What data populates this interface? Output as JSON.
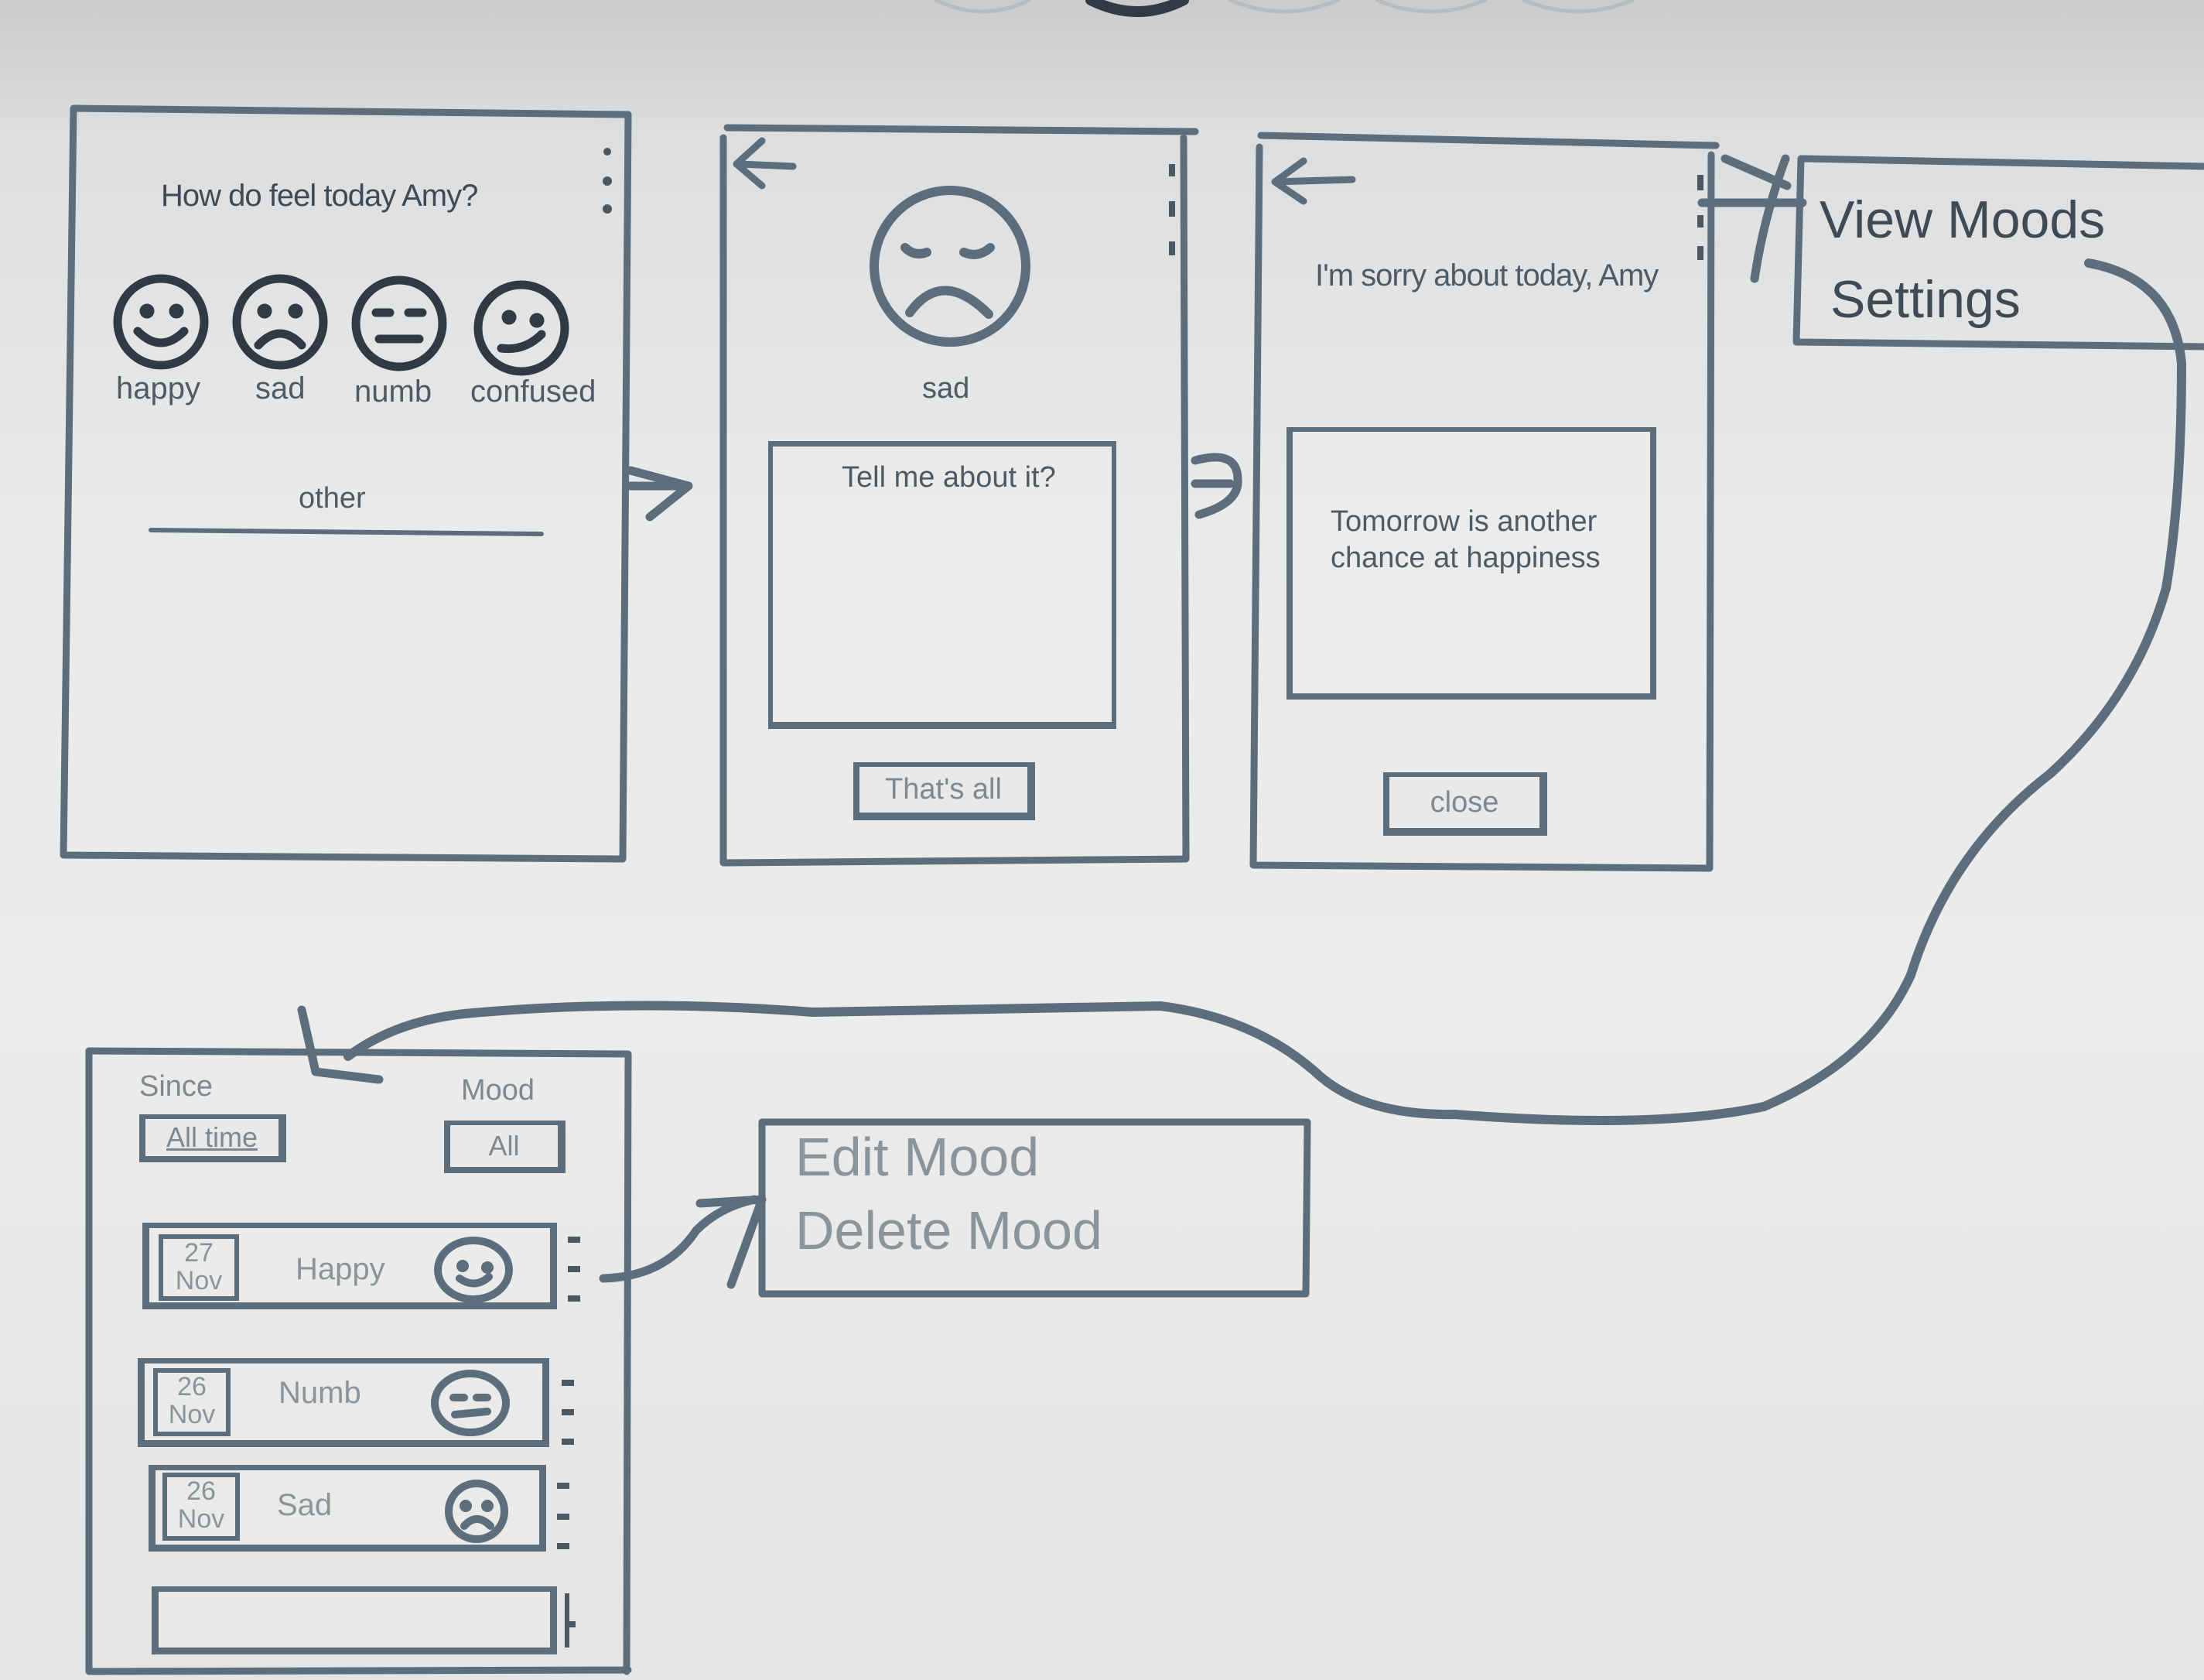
{
  "screen1": {
    "question": "How do feel today Amy?",
    "moods": [
      {
        "label": "happy",
        "icon": "happy-face-icon"
      },
      {
        "label": "sad",
        "icon": "sad-face-icon"
      },
      {
        "label": "numb",
        "icon": "numb-face-icon"
      },
      {
        "label": "confused",
        "icon": "confused-face-icon"
      }
    ],
    "other_label": "other"
  },
  "screen2": {
    "mood_label": "sad",
    "prompt": "Tell me about it?",
    "done_button": "That's all"
  },
  "screen3": {
    "message": "I'm sorry about today, Amy",
    "quote_line1": "Tomorrow is another",
    "quote_line2": "chance at happiness",
    "close_button": "close"
  },
  "overflow_menu": {
    "items": [
      "View Moods",
      "Settings"
    ]
  },
  "mood_list": {
    "since_label": "Since",
    "since_value": "All time",
    "mood_label": "Mood",
    "mood_value": "All",
    "entries": [
      {
        "day": "27",
        "month": "Nov",
        "mood": "Happy",
        "icon": "happy-face-icon"
      },
      {
        "day": "26",
        "month": "Nov",
        "mood": "Numb",
        "icon": "numb-face-icon"
      },
      {
        "day": "26",
        "month": "Nov",
        "mood": "Sad",
        "icon": "sad-face-icon"
      }
    ]
  },
  "entry_menu": {
    "items": [
      "Edit Mood",
      "Delete Mood"
    ]
  },
  "colors": {
    "ink": "#5c6e7c",
    "text": "#4e5b66",
    "paper": "#ececea"
  }
}
